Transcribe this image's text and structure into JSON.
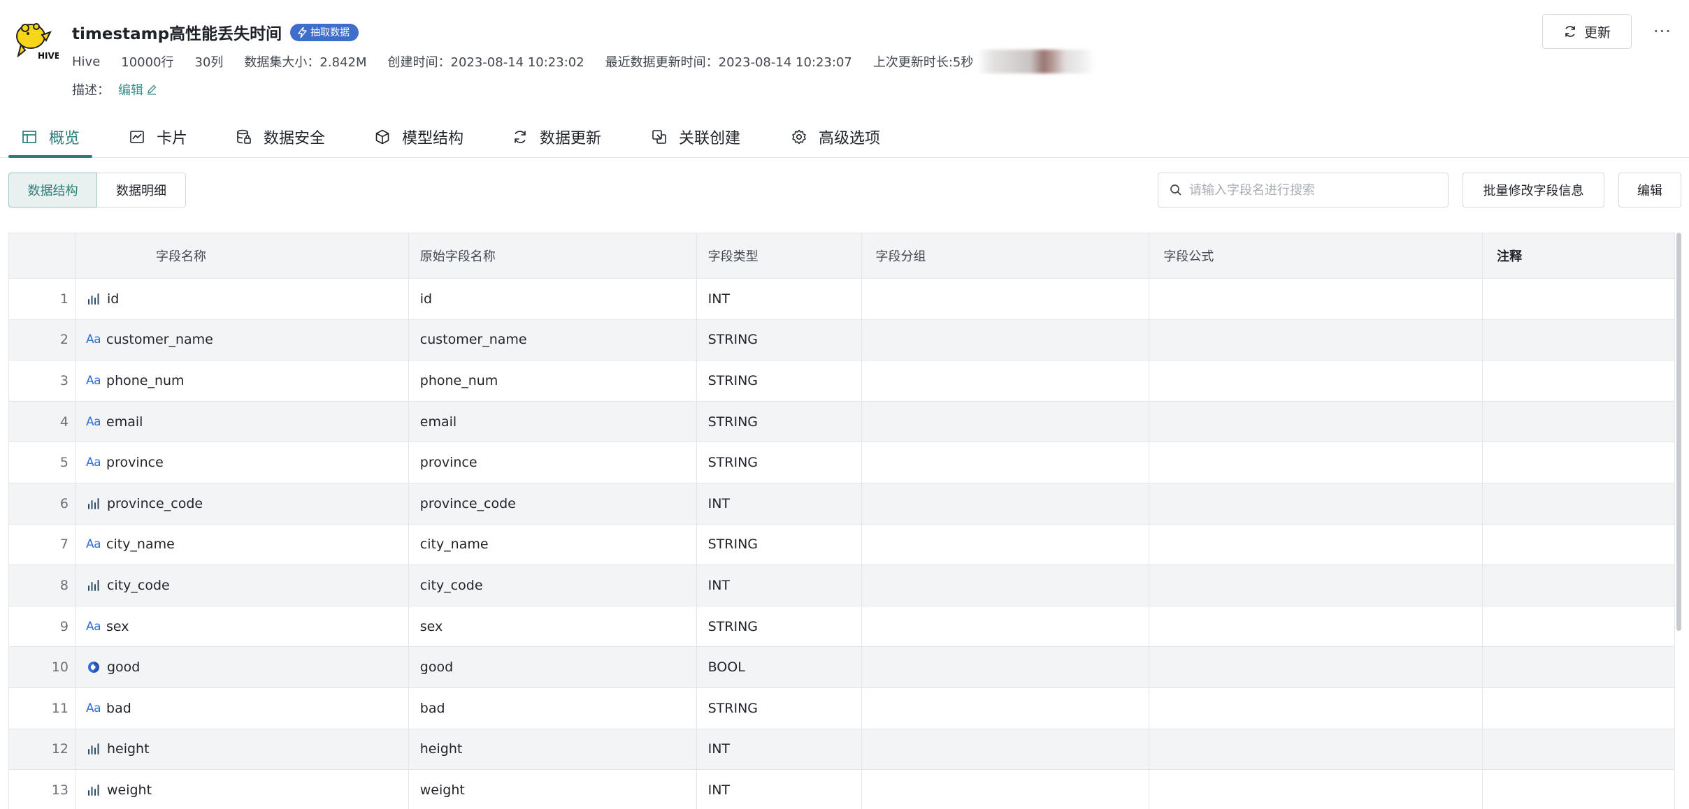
{
  "header": {
    "title": "timestamp高性能丢失时间",
    "badge": "抽取数据",
    "logo_icon": "hive-logo",
    "meta": {
      "source": "Hive",
      "rows": "10000行",
      "cols": "30列",
      "size": "数据集大小：2.842M",
      "created": "创建时间：2023-08-14 10:23:02",
      "updated": "最近数据更新时间：2023-08-14 10:23:07",
      "last_duration": "上次更新时长:5秒"
    },
    "desc_label": "描述：",
    "desc_edit": "编辑",
    "update_button": "更新",
    "more_button": "···"
  },
  "tabs": [
    {
      "label": "概览",
      "icon": "table-icon",
      "active": true
    },
    {
      "label": "卡片",
      "icon": "chart-icon"
    },
    {
      "label": "数据安全",
      "icon": "database-lock-icon"
    },
    {
      "label": "模型结构",
      "icon": "cube-icon"
    },
    {
      "label": "数据更新",
      "icon": "refresh-icon"
    },
    {
      "label": "关联创建",
      "icon": "link-copy-icon"
    },
    {
      "label": "高级选项",
      "icon": "gear-icon"
    }
  ],
  "toolbar": {
    "seg_structure": "数据结构",
    "seg_detail": "数据明细",
    "search_placeholder": "请输入字段名进行搜索",
    "batch_button": "批量修改字段信息",
    "edit_button": "编辑"
  },
  "table": {
    "columns": [
      "字段名称",
      "原始字段名称",
      "字段类型",
      "字段分组",
      "字段公式",
      "注释"
    ],
    "rows": [
      {
        "num": "1",
        "icon": "number",
        "name": "id",
        "original": "id",
        "type": "INT",
        "group": "",
        "formula": "",
        "note": ""
      },
      {
        "num": "2",
        "icon": "string",
        "name": "customer_name",
        "original": "customer_name",
        "type": "STRING",
        "group": "",
        "formula": "",
        "note": ""
      },
      {
        "num": "3",
        "icon": "string",
        "name": "phone_num",
        "original": "phone_num",
        "type": "STRING",
        "group": "",
        "formula": "",
        "note": ""
      },
      {
        "num": "4",
        "icon": "string",
        "name": "email",
        "original": "email",
        "type": "STRING",
        "group": "",
        "formula": "",
        "note": ""
      },
      {
        "num": "5",
        "icon": "string",
        "name": "province",
        "original": "province",
        "type": "STRING",
        "group": "",
        "formula": "",
        "note": ""
      },
      {
        "num": "6",
        "icon": "number",
        "name": "province_code",
        "original": "province_code",
        "type": "INT",
        "group": "",
        "formula": "",
        "note": ""
      },
      {
        "num": "7",
        "icon": "string",
        "name": "city_name",
        "original": "city_name",
        "type": "STRING",
        "group": "",
        "formula": "",
        "note": ""
      },
      {
        "num": "8",
        "icon": "number",
        "name": "city_code",
        "original": "city_code",
        "type": "INT",
        "group": "",
        "formula": "",
        "note": ""
      },
      {
        "num": "9",
        "icon": "string",
        "name": "sex",
        "original": "sex",
        "type": "STRING",
        "group": "",
        "formula": "",
        "note": ""
      },
      {
        "num": "10",
        "icon": "bool",
        "name": "good",
        "original": "good",
        "type": "BOOL",
        "group": "",
        "formula": "",
        "note": ""
      },
      {
        "num": "11",
        "icon": "string",
        "name": "bad",
        "original": "bad",
        "type": "STRING",
        "group": "",
        "formula": "",
        "note": ""
      },
      {
        "num": "12",
        "icon": "number",
        "name": "height",
        "original": "height",
        "type": "INT",
        "group": "",
        "formula": "",
        "note": ""
      },
      {
        "num": "13",
        "icon": "number",
        "name": "weight",
        "original": "weight",
        "type": "INT",
        "group": "",
        "formula": "",
        "note": ""
      }
    ]
  },
  "colors": {
    "accent": "#2a7d78",
    "badge": "#3d6ecc",
    "string_icon": "#2f6ed8",
    "row_stripe": "#f3f4f6"
  }
}
